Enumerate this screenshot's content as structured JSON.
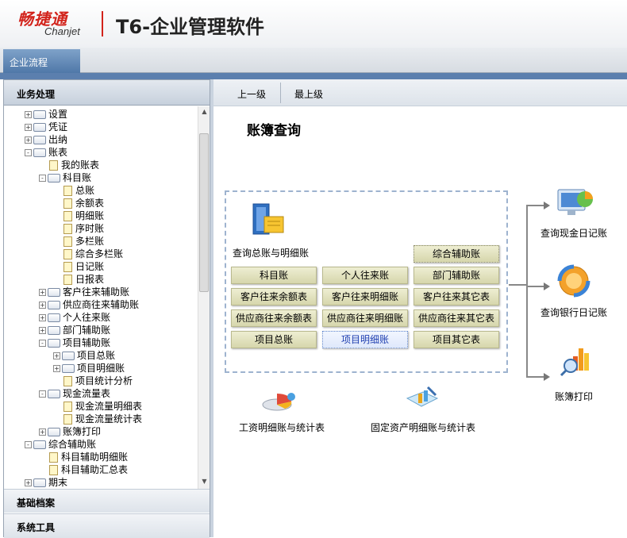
{
  "header": {
    "logo_cn": "畅捷通",
    "logo_en": "Chanjet",
    "product_title": "T6-企业管理软件"
  },
  "tabs": {
    "flow": "企业流程"
  },
  "left": {
    "work_title": "业务处理",
    "base_title": "基础档案",
    "tools_title": "系统工具",
    "tree": [
      {
        "label": "设置",
        "type": "folder",
        "exp": "+"
      },
      {
        "label": "凭证",
        "type": "folder",
        "exp": "+"
      },
      {
        "label": "出纳",
        "type": "folder",
        "exp": "+"
      },
      {
        "label": "账表",
        "type": "folder",
        "exp": "-"
      },
      {
        "label": "我的账表",
        "type": "doc"
      },
      {
        "label": "科目账",
        "type": "folder",
        "exp": "-"
      },
      {
        "label": "总账",
        "type": "doc"
      },
      {
        "label": "余额表",
        "type": "doc"
      },
      {
        "label": "明细账",
        "type": "doc"
      },
      {
        "label": "序时账",
        "type": "doc"
      },
      {
        "label": "多栏账",
        "type": "doc"
      },
      {
        "label": "综合多栏账",
        "type": "doc"
      },
      {
        "label": "日记账",
        "type": "doc"
      },
      {
        "label": "日报表",
        "type": "doc"
      },
      {
        "label": "客户往来辅助账",
        "type": "folder",
        "exp": "+"
      },
      {
        "label": "供应商往来辅助账",
        "type": "folder",
        "exp": "+"
      },
      {
        "label": "个人往来账",
        "type": "folder",
        "exp": "+"
      },
      {
        "label": "部门辅助账",
        "type": "folder",
        "exp": "+"
      },
      {
        "label": "项目辅助账",
        "type": "folder",
        "exp": "-"
      },
      {
        "label": "项目总账",
        "type": "folder",
        "exp": "+"
      },
      {
        "label": "项目明细账",
        "type": "folder",
        "exp": "+"
      },
      {
        "label": "项目统计分析",
        "type": "doc"
      },
      {
        "label": "现金流量表",
        "type": "folder",
        "exp": "-"
      },
      {
        "label": "现金流量明细表",
        "type": "doc"
      },
      {
        "label": "现金流量统计表",
        "type": "doc"
      },
      {
        "label": "账簿打印",
        "type": "folder",
        "exp": "+"
      },
      {
        "label": "综合辅助账",
        "type": "folder",
        "exp": "-"
      },
      {
        "label": "科目辅助明细账",
        "type": "doc"
      },
      {
        "label": "科目辅助汇总表",
        "type": "doc"
      },
      {
        "label": "期末",
        "type": "folder",
        "exp": "+"
      }
    ]
  },
  "nav": {
    "up": "上一级",
    "top": "最上级"
  },
  "page": {
    "title": "账簿查询"
  },
  "flow": {
    "main_label": "查询总账与明细账",
    "aux_btn": "综合辅助账",
    "grid": [
      [
        "科目账",
        "个人往来账",
        "部门辅助账"
      ],
      [
        "客户往来余额表",
        "客户往来明细账",
        "客户往来其它表"
      ],
      [
        "供应商往来余额表",
        "供应商往来明细账",
        "供应商往来其它表"
      ],
      [
        "项目总账",
        "项目明细账",
        "项目其它表"
      ]
    ],
    "salary_label": "工资明细账与统计表",
    "asset_label": "固定资产明细账与统计表",
    "cash_label": "查询现金日记账",
    "bank_label": "查询银行日记账",
    "print_label": "账簿打印"
  }
}
